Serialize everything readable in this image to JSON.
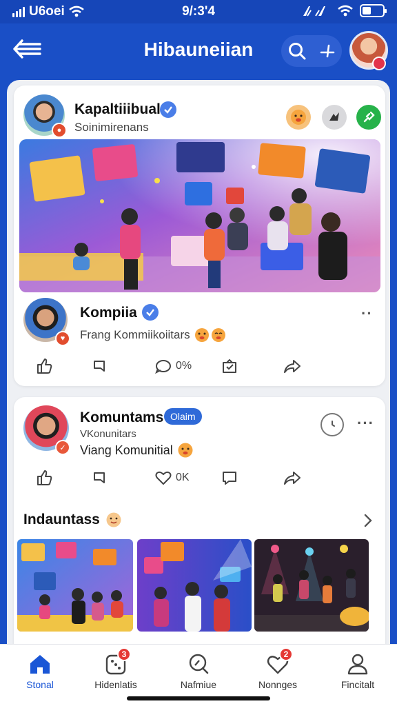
{
  "status_bar": {
    "carrier": "U6oei",
    "time": "9/:3'4"
  },
  "header": {
    "title": "Hibauneiian"
  },
  "post1": {
    "author": "Kapaltiiibual",
    "subtitle": "Soinimirenans"
  },
  "comment": {
    "author": "Kompiia",
    "text": "Frang Kommiikoiitars",
    "reaction_count": "0%"
  },
  "post2": {
    "author": "Komuntams",
    "badge": "Olaim",
    "handle": "VKonunitars",
    "text": "Viang Komunitial",
    "reaction_count": "0K"
  },
  "section": {
    "title": "Indauntass"
  },
  "bottom_nav": {
    "items": [
      {
        "label": "Stonal",
        "icon": "home-icon",
        "active": true
      },
      {
        "label": "Hidenlatis",
        "icon": "dice-icon",
        "badge": "3"
      },
      {
        "label": "Nafmiue",
        "icon": "search-icon"
      },
      {
        "label": "Nonnges",
        "icon": "heart-chat-icon",
        "badge": "2"
      },
      {
        "label": "Fincitalt",
        "icon": "profile-icon"
      }
    ]
  },
  "colors": {
    "primary_blue": "#1a4fc6",
    "active_nav": "#1a56d6",
    "badge_red": "#e53935",
    "verified_blue": "#4a7ee8"
  }
}
